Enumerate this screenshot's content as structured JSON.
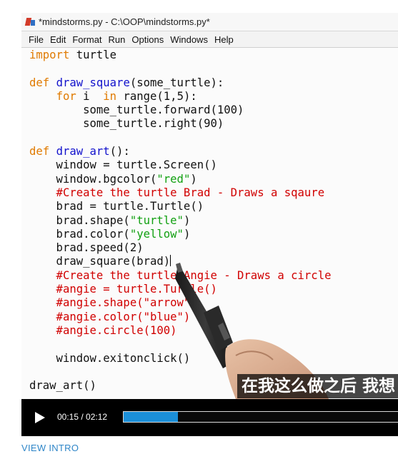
{
  "window": {
    "title": "*mindstorms.py - C:\\OOP\\mindstorms.py*"
  },
  "menubar": {
    "items": [
      "File",
      "Edit",
      "Format",
      "Run",
      "Options",
      "Windows",
      "Help"
    ]
  },
  "code": {
    "l1a": "import",
    "l1b": " turtle",
    "l3a": "def",
    "l3b": " ",
    "l3c": "draw_square",
    "l3d": "(some_turtle):",
    "l4a": "    ",
    "l4b": "for",
    "l4c": " i  ",
    "l4d": "in",
    "l4e": " range(1,5):",
    "l5": "        some_turtle.forward(100)",
    "l6": "        some_turtle.right(90)",
    "l8a": "def",
    "l8b": " ",
    "l8c": "draw_art",
    "l8d": "():",
    "l9": "    window = turtle.Screen()",
    "l10a": "    window.bgcolor(",
    "l10b": "\"red\"",
    "l10c": ")",
    "l11": "    #Create the turtle Brad - Draws a sqaure",
    "l12": "    brad = turtle.Turtle()",
    "l13a": "    brad.shape(",
    "l13b": "\"turtle\"",
    "l13c": ")",
    "l14a": "    brad.color(",
    "l14b": "\"yellow\"",
    "l14c": ")",
    "l15": "    brad.speed(2)",
    "l16": "    draw_square(brad)",
    "l17": "    #Create the turtle Angie - Draws a circle",
    "l18": "    #angie = turtle.Turtle()",
    "l19": "    #angie.shape(\"arrow\")",
    "l20": "    #angie.color(\"blue\")",
    "l21": "    #angie.circle(100)",
    "l23": "    window.exitonclick()",
    "l25": "draw_art()"
  },
  "subtitle": "在我这么做之后 我想",
  "player": {
    "time_display": "00:15 / 02:12",
    "progress_fraction": 0.19,
    "accent": "#1b8fd8",
    "play_icon": "play-icon"
  },
  "link": {
    "view_intro": "VIEW INTRO"
  },
  "colors": {
    "keyword": "#e07a00",
    "function": "#1111cc",
    "string": "#11a011",
    "comment": "#d10000",
    "link": "#2f86c8"
  }
}
